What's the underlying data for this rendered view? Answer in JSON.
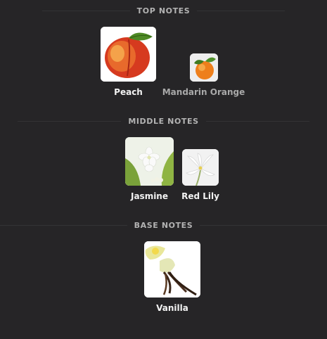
{
  "sections": [
    {
      "title": "TOP NOTES",
      "notes": [
        {
          "name": "Peach",
          "icon": "peach-icon"
        },
        {
          "name": "Mandarin Orange",
          "icon": "mandarin-orange-icon"
        }
      ]
    },
    {
      "title": "MIDDLE NOTES",
      "notes": [
        {
          "name": "Jasmine",
          "icon": "jasmine-icon"
        },
        {
          "name": "Red Lily",
          "icon": "red-lily-icon"
        }
      ]
    },
    {
      "title": "BASE NOTES",
      "notes": [
        {
          "name": "Vanilla",
          "icon": "vanilla-icon"
        }
      ]
    }
  ],
  "colors": {
    "background": "#262527",
    "label_primary": "#f3f3f3",
    "label_secondary": "#a9a9a9",
    "section_title": "#b3b3b3",
    "divider": "#333335"
  }
}
